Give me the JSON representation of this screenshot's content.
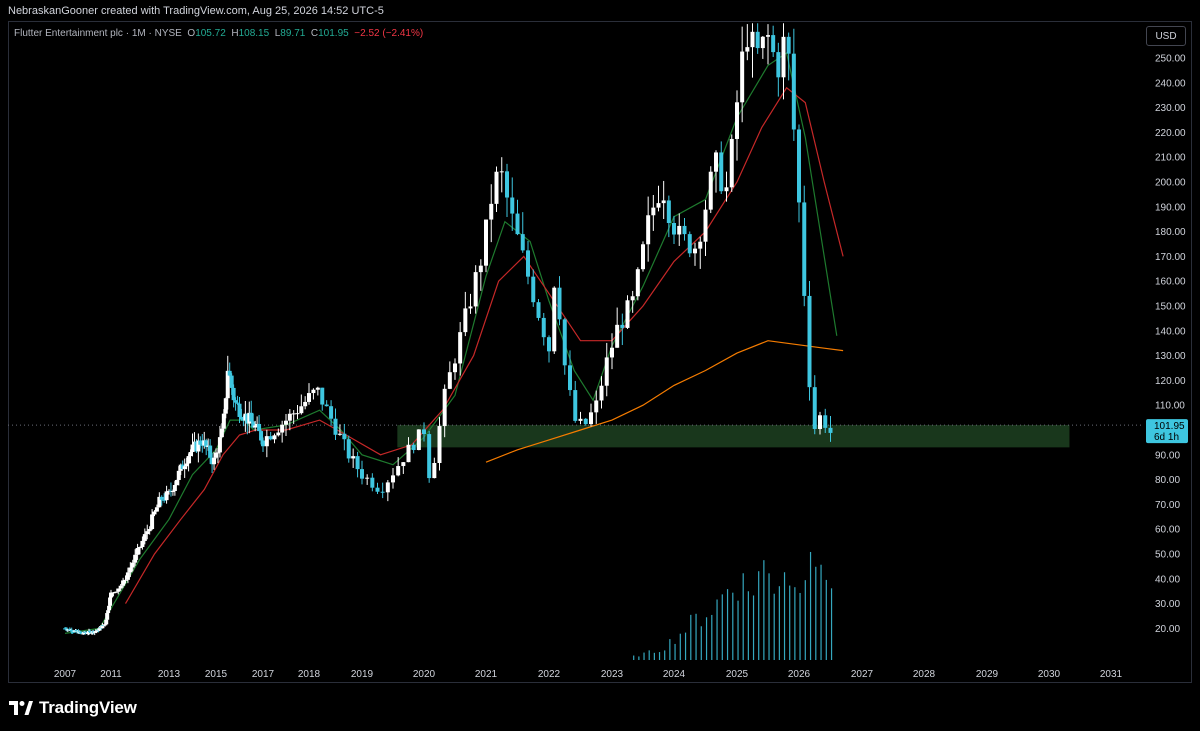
{
  "caption": "NebraskanGooner created with TradingView.com, Aug 25, 2026 14:52 UTC-5",
  "legend": {
    "symbol": "Flutter Entertainment plc · 1M · NYSE",
    "open_label": "O",
    "open": "105.72",
    "high_label": "H",
    "high": "108.15",
    "low_label": "L",
    "low": "89.71",
    "close_label": "C",
    "close": "101.95",
    "change": "−2.52 (−2.41%)"
  },
  "currency": "USD",
  "price_tag": {
    "price": "101.95",
    "countdown": "6d 1h"
  },
  "brand": "TradingView",
  "colors": {
    "up": "#ffffff",
    "down": "#3ec6e0",
    "ema_fast": "#1e7a2e",
    "ema_mid": "#c62828",
    "ema_slow": "#f57c00",
    "zone_fill": "#1c3d1f",
    "volume": "#3ec6e0"
  },
  "chart_data": {
    "type": "candlestick",
    "interval": "1M",
    "y_axis": {
      "ticks": [
        20,
        30,
        40,
        50,
        60,
        70,
        80,
        90,
        100,
        110,
        120,
        130,
        140,
        150,
        160,
        170,
        180,
        190,
        200,
        210,
        220,
        230,
        240,
        250
      ],
      "labels": [
        "20.00",
        "30.00",
        "40.00",
        "50.00",
        "60.00",
        "70.00",
        "80.00",
        "90.00",
        "100.00",
        "110.00",
        "120.00",
        "130.00",
        "140.00",
        "150.00",
        "160.00",
        "170.00",
        "180.00",
        "190.00",
        "200.00",
        "210.00",
        "220.00",
        "230.00",
        "240.00",
        "250.00"
      ],
      "ylim": [
        12,
        262
      ]
    },
    "x_axis": {
      "labels": [
        "2007",
        "2011",
        "2013",
        "2015",
        "2017",
        "2018",
        "2019",
        "2020",
        "2021",
        "2022",
        "2023",
        "2024",
        "2025",
        "2026",
        "2027",
        "2028",
        "2029",
        "2030",
        "2031"
      ]
    },
    "support_zone": {
      "low": 93,
      "high": 102,
      "start_year": 2019.57,
      "end_year": 2030.33
    },
    "current_price": 101.95,
    "anchor_points": [
      [
        2007.0,
        20
      ],
      [
        2008.5,
        18
      ],
      [
        2009.8,
        19
      ],
      [
        2010.5,
        22
      ],
      [
        2011.0,
        34
      ],
      [
        2011.4,
        38
      ],
      [
        2011.8,
        48
      ],
      [
        2012.2,
        58
      ],
      [
        2012.7,
        72
      ],
      [
        2013.0,
        74
      ],
      [
        2013.35,
        81
      ],
      [
        2013.8,
        90
      ],
      [
        2014.4,
        96
      ],
      [
        2014.9,
        87
      ],
      [
        2015.3,
        100
      ],
      [
        2015.5,
        125
      ],
      [
        2015.8,
        111
      ],
      [
        2016.2,
        106
      ],
      [
        2016.6,
        102
      ],
      [
        2017.0,
        96
      ],
      [
        2017.5,
        104
      ],
      [
        2017.9,
        111
      ],
      [
        2018.15,
        116
      ],
      [
        2018.5,
        101
      ],
      [
        2018.75,
        90
      ],
      [
        2019.0,
        82
      ],
      [
        2019.3,
        76
      ],
      [
        2019.5,
        83
      ],
      [
        2019.75,
        92
      ],
      [
        2020.0,
        100
      ],
      [
        2020.1,
        79
      ],
      [
        2020.35,
        116
      ],
      [
        2020.7,
        148
      ],
      [
        2020.95,
        172
      ],
      [
        2021.1,
        196
      ],
      [
        2021.22,
        205
      ],
      [
        2021.4,
        186
      ],
      [
        2021.6,
        168
      ],
      [
        2021.85,
        146
      ],
      [
        2022.0,
        133
      ],
      [
        2022.1,
        166
      ],
      [
        2022.25,
        126
      ],
      [
        2022.4,
        104
      ],
      [
        2022.55,
        101
      ],
      [
        2022.75,
        110
      ],
      [
        2022.9,
        126
      ],
      [
        2023.1,
        142
      ],
      [
        2023.35,
        152
      ],
      [
        2023.6,
        185
      ],
      [
        2023.8,
        200
      ],
      [
        2023.95,
        186
      ],
      [
        2024.1,
        177
      ],
      [
        2024.35,
        174
      ],
      [
        2024.65,
        207
      ],
      [
        2024.85,
        196
      ],
      [
        2025.0,
        232
      ],
      [
        2025.15,
        262
      ],
      [
        2025.3,
        250
      ],
      [
        2025.5,
        258
      ],
      [
        2025.65,
        246
      ],
      [
        2025.8,
        260
      ],
      [
        2025.95,
        210
      ],
      [
        2026.05,
        172
      ],
      [
        2026.15,
        124
      ],
      [
        2026.25,
        101
      ],
      [
        2026.35,
        106
      ],
      [
        2026.5,
        99
      ],
      [
        2026.58,
        101.95
      ]
    ],
    "ema_fast_points": [
      [
        2007.0,
        18
      ],
      [
        2010.0,
        20
      ],
      [
        2011.0,
        28
      ],
      [
        2012.0,
        48
      ],
      [
        2013.0,
        64
      ],
      [
        2014.0,
        82
      ],
      [
        2015.0,
        92
      ],
      [
        2015.6,
        104
      ],
      [
        2016.2,
        104
      ],
      [
        2016.6,
        100
      ],
      [
        2017.5,
        102
      ],
      [
        2018.2,
        108
      ],
      [
        2018.6,
        100
      ],
      [
        2019.0,
        90
      ],
      [
        2019.5,
        86
      ],
      [
        2020.0,
        97
      ],
      [
        2020.5,
        114
      ],
      [
        2021.0,
        162
      ],
      [
        2021.3,
        184
      ],
      [
        2021.7,
        176
      ],
      [
        2022.0,
        152
      ],
      [
        2022.4,
        124
      ],
      [
        2022.7,
        112
      ],
      [
        2023.0,
        134
      ],
      [
        2023.5,
        158
      ],
      [
        2024.0,
        186
      ],
      [
        2024.5,
        193
      ],
      [
        2025.0,
        226
      ],
      [
        2025.5,
        247
      ],
      [
        2025.8,
        252
      ],
      [
        2026.1,
        218
      ],
      [
        2026.3,
        186
      ],
      [
        2026.6,
        138
      ]
    ],
    "ema_mid_points": [
      [
        2011.5,
        30
      ],
      [
        2012.5,
        50
      ],
      [
        2013.5,
        64
      ],
      [
        2014.5,
        76
      ],
      [
        2015.3,
        90
      ],
      [
        2016.0,
        98
      ],
      [
        2016.7,
        100
      ],
      [
        2017.5,
        100
      ],
      [
        2018.2,
        104
      ],
      [
        2018.7,
        98
      ],
      [
        2019.3,
        90
      ],
      [
        2019.8,
        94
      ],
      [
        2020.3,
        108
      ],
      [
        2020.8,
        130
      ],
      [
        2021.2,
        160
      ],
      [
        2021.6,
        170
      ],
      [
        2022.0,
        155
      ],
      [
        2022.5,
        136
      ],
      [
        2023.0,
        136
      ],
      [
        2023.5,
        150
      ],
      [
        2024.0,
        168
      ],
      [
        2024.5,
        180
      ],
      [
        2025.0,
        200
      ],
      [
        2025.4,
        222
      ],
      [
        2025.8,
        238
      ],
      [
        2026.1,
        232
      ],
      [
        2026.4,
        200
      ],
      [
        2026.7,
        170
      ]
    ],
    "ema_slow_points": [
      [
        2021.0,
        87
      ],
      [
        2021.5,
        92
      ],
      [
        2022.0,
        96
      ],
      [
        2022.5,
        100
      ],
      [
        2023.0,
        104
      ],
      [
        2023.5,
        110
      ],
      [
        2024.0,
        118
      ],
      [
        2024.5,
        124
      ],
      [
        2025.0,
        131
      ],
      [
        2025.5,
        136
      ],
      [
        2025.8,
        135
      ],
      [
        2026.1,
        134
      ],
      [
        2026.4,
        133
      ],
      [
        2026.7,
        132
      ]
    ],
    "volume_points": [
      [
        2023.35,
        2
      ],
      [
        2023.8,
        6
      ],
      [
        2024.1,
        15
      ],
      [
        2024.4,
        24
      ],
      [
        2024.65,
        30
      ],
      [
        2024.85,
        40
      ],
      [
        2025.0,
        46
      ],
      [
        2025.2,
        38
      ],
      [
        2025.4,
        52
      ],
      [
        2025.6,
        44
      ],
      [
        2025.8,
        55
      ],
      [
        2025.95,
        36
      ],
      [
        2026.1,
        62
      ],
      [
        2026.2,
        75
      ],
      [
        2026.35,
        42
      ],
      [
        2026.5,
        50
      ],
      [
        2026.58,
        48
      ]
    ]
  }
}
